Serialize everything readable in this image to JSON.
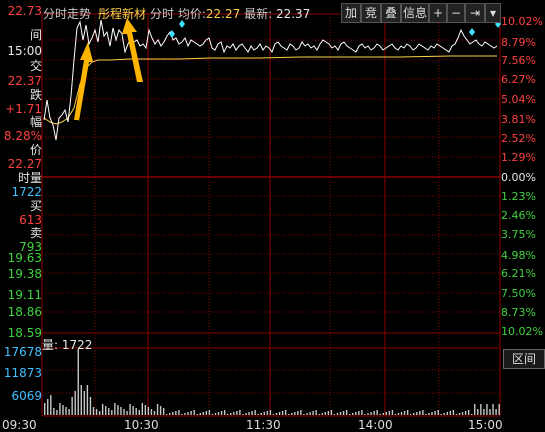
{
  "toolbar": {
    "title": "分时走势",
    "stock_name": "彤程新材",
    "mode_label": "分时",
    "avg_label": "均价:",
    "avg_value": "22.27",
    "latest_label": "最新:",
    "latest_value": "22.37",
    "btn_add": "加",
    "btn_compete": "竞",
    "btn_overlay": "叠",
    "btn_info": "信息",
    "btn_plus": "+",
    "btn_minus": "−",
    "btn_next": "⇥",
    "btn_more": "▾"
  },
  "left_panel": {
    "price_top": "22.73",
    "time_label": "间",
    "time_value": "15:00",
    "trade_label": "交",
    "trade_value": "22.37",
    "change_label": "跌",
    "change_value": "+1.71",
    "range_label": "幅",
    "range_value": "8.28%",
    "avg_label": "价",
    "avg_value": "22.27",
    "volume_label": "时量",
    "volume_value": "1722",
    "buy_label": "买",
    "buy_value": "613",
    "sell_label": "卖",
    "sell_value": "793",
    "price_1963": "19.63",
    "price_1938": "19.38",
    "price_1911": "19.11",
    "price_1886": "18.86",
    "price_1859": "18.59"
  },
  "right_axis": {
    "p1": "10.02%",
    "p2": "8.79%",
    "p3": "7.56%",
    "p4": "6.27%",
    "p5": "5.04%",
    "p6": "3.81%",
    "p7": "2.52%",
    "p8": "1.29%",
    "zero": "0.00%",
    "n1": "1.23%",
    "n2": "2.46%",
    "n3": "3.75%",
    "n4": "4.98%",
    "n5": "6.21%",
    "n6": "7.50%",
    "n7": "8.73%",
    "n8": "10.02%"
  },
  "volume_panel": {
    "label": "量: 1722",
    "v1": "17678",
    "v2": "11873",
    "v3": "6069",
    "button": "区间"
  },
  "x_axis": {
    "t0": "09:30",
    "t1": "10:30",
    "t2": "11:30",
    "t3": "14:00",
    "t4": "15:00"
  },
  "colors": {
    "grid": "#8b0000",
    "price_line": "#ffffff",
    "avg_line": "#ffd24a",
    "volume": "#c8c8c8",
    "annotation_arrow": "#ffb400"
  }
}
